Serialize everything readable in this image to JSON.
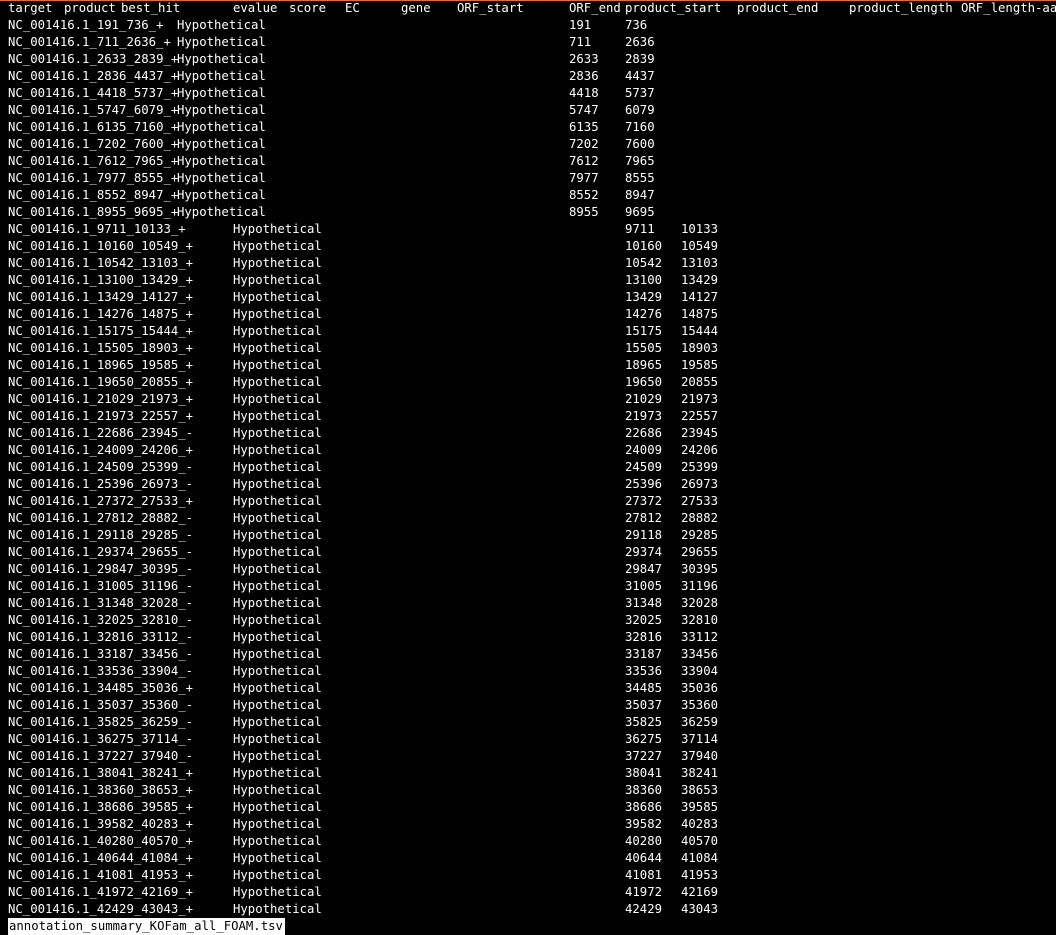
{
  "window": {
    "accent_color": "#e86a2e",
    "background_color": "#000000",
    "text_color": "#ffffff"
  },
  "header": [
    "target",
    "product",
    "best_hit",
    "evalue",
    "score",
    "EC",
    "gene",
    "ORF_start",
    "ORF_end",
    "product_start",
    "product_end",
    "product_length",
    "ORF_length-aa"
  ],
  "rows": [
    {
      "target": "NC_001416.1_191_736_+",
      "product": "Hypothetical",
      "start": "191",
      "end": "736",
      "shifted": false
    },
    {
      "target": "NC_001416.1_711_2636_+",
      "product": "Hypothetical",
      "start": "711",
      "end": "2636",
      "shifted": false
    },
    {
      "target": "NC_001416.1_2633_2839_+",
      "product": "Hypothetical",
      "start": "2633",
      "end": "2839",
      "shifted": false
    },
    {
      "target": "NC_001416.1_2836_4437_+",
      "product": "Hypothetical",
      "start": "2836",
      "end": "4437",
      "shifted": false
    },
    {
      "target": "NC_001416.1_4418_5737_+",
      "product": "Hypothetical",
      "start": "4418",
      "end": "5737",
      "shifted": false
    },
    {
      "target": "NC_001416.1_5747_6079_+",
      "product": "Hypothetical",
      "start": "5747",
      "end": "6079",
      "shifted": false
    },
    {
      "target": "NC_001416.1_6135_7160_+",
      "product": "Hypothetical",
      "start": "6135",
      "end": "7160",
      "shifted": false
    },
    {
      "target": "NC_001416.1_7202_7600_+",
      "product": "Hypothetical",
      "start": "7202",
      "end": "7600",
      "shifted": false
    },
    {
      "target": "NC_001416.1_7612_7965_+",
      "product": "Hypothetical",
      "start": "7612",
      "end": "7965",
      "shifted": false
    },
    {
      "target": "NC_001416.1_7977_8555_+",
      "product": "Hypothetical",
      "start": "7977",
      "end": "8555",
      "shifted": false
    },
    {
      "target": "NC_001416.1_8552_8947_+",
      "product": "Hypothetical",
      "start": "8552",
      "end": "8947",
      "shifted": false
    },
    {
      "target": "NC_001416.1_8955_9695_+",
      "product": "Hypothetical",
      "start": "8955",
      "end": "9695",
      "shifted": false
    },
    {
      "target": "NC_001416.1_9711_10133_+",
      "product": "Hypothetical",
      "start": "9711",
      "end": "10133",
      "shifted": true
    },
    {
      "target": "NC_001416.1_10160_10549_+",
      "product": "Hypothetical",
      "start": "10160",
      "end": "10549",
      "shifted": true
    },
    {
      "target": "NC_001416.1_10542_13103_+",
      "product": "Hypothetical",
      "start": "10542",
      "end": "13103",
      "shifted": true
    },
    {
      "target": "NC_001416.1_13100_13429_+",
      "product": "Hypothetical",
      "start": "13100",
      "end": "13429",
      "shifted": true
    },
    {
      "target": "NC_001416.1_13429_14127_+",
      "product": "Hypothetical",
      "start": "13429",
      "end": "14127",
      "shifted": true
    },
    {
      "target": "NC_001416.1_14276_14875_+",
      "product": "Hypothetical",
      "start": "14276",
      "end": "14875",
      "shifted": true
    },
    {
      "target": "NC_001416.1_15175_15444_+",
      "product": "Hypothetical",
      "start": "15175",
      "end": "15444",
      "shifted": true
    },
    {
      "target": "NC_001416.1_15505_18903_+",
      "product": "Hypothetical",
      "start": "15505",
      "end": "18903",
      "shifted": true
    },
    {
      "target": "NC_001416.1_18965_19585_+",
      "product": "Hypothetical",
      "start": "18965",
      "end": "19585",
      "shifted": true
    },
    {
      "target": "NC_001416.1_19650_20855_+",
      "product": "Hypothetical",
      "start": "19650",
      "end": "20855",
      "shifted": true
    },
    {
      "target": "NC_001416.1_21029_21973_+",
      "product": "Hypothetical",
      "start": "21029",
      "end": "21973",
      "shifted": true
    },
    {
      "target": "NC_001416.1_21973_22557_+",
      "product": "Hypothetical",
      "start": "21973",
      "end": "22557",
      "shifted": true
    },
    {
      "target": "NC_001416.1_22686_23945_-",
      "product": "Hypothetical",
      "start": "22686",
      "end": "23945",
      "shifted": true
    },
    {
      "target": "NC_001416.1_24009_24206_+",
      "product": "Hypothetical",
      "start": "24009",
      "end": "24206",
      "shifted": true
    },
    {
      "target": "NC_001416.1_24509_25399_-",
      "product": "Hypothetical",
      "start": "24509",
      "end": "25399",
      "shifted": true
    },
    {
      "target": "NC_001416.1_25396_26973_-",
      "product": "Hypothetical",
      "start": "25396",
      "end": "26973",
      "shifted": true
    },
    {
      "target": "NC_001416.1_27372_27533_+",
      "product": "Hypothetical",
      "start": "27372",
      "end": "27533",
      "shifted": true
    },
    {
      "target": "NC_001416.1_27812_28882_-",
      "product": "Hypothetical",
      "start": "27812",
      "end": "28882",
      "shifted": true
    },
    {
      "target": "NC_001416.1_29118_29285_-",
      "product": "Hypothetical",
      "start": "29118",
      "end": "29285",
      "shifted": true
    },
    {
      "target": "NC_001416.1_29374_29655_-",
      "product": "Hypothetical",
      "start": "29374",
      "end": "29655",
      "shifted": true
    },
    {
      "target": "NC_001416.1_29847_30395_-",
      "product": "Hypothetical",
      "start": "29847",
      "end": "30395",
      "shifted": true
    },
    {
      "target": "NC_001416.1_31005_31196_-",
      "product": "Hypothetical",
      "start": "31005",
      "end": "31196",
      "shifted": true
    },
    {
      "target": "NC_001416.1_31348_32028_-",
      "product": "Hypothetical",
      "start": "31348",
      "end": "32028",
      "shifted": true
    },
    {
      "target": "NC_001416.1_32025_32810_-",
      "product": "Hypothetical",
      "start": "32025",
      "end": "32810",
      "shifted": true
    },
    {
      "target": "NC_001416.1_32816_33112_-",
      "product": "Hypothetical",
      "start": "32816",
      "end": "33112",
      "shifted": true
    },
    {
      "target": "NC_001416.1_33187_33456_-",
      "product": "Hypothetical",
      "start": "33187",
      "end": "33456",
      "shifted": true
    },
    {
      "target": "NC_001416.1_33536_33904_-",
      "product": "Hypothetical",
      "start": "33536",
      "end": "33904",
      "shifted": true
    },
    {
      "target": "NC_001416.1_34485_35036_+",
      "product": "Hypothetical",
      "start": "34485",
      "end": "35036",
      "shifted": true
    },
    {
      "target": "NC_001416.1_35037_35360_-",
      "product": "Hypothetical",
      "start": "35037",
      "end": "35360",
      "shifted": true
    },
    {
      "target": "NC_001416.1_35825_36259_-",
      "product": "Hypothetical",
      "start": "35825",
      "end": "36259",
      "shifted": true
    },
    {
      "target": "NC_001416.1_36275_37114_-",
      "product": "Hypothetical",
      "start": "36275",
      "end": "37114",
      "shifted": true
    },
    {
      "target": "NC_001416.1_37227_37940_-",
      "product": "Hypothetical",
      "start": "37227",
      "end": "37940",
      "shifted": true
    },
    {
      "target": "NC_001416.1_38041_38241_+",
      "product": "Hypothetical",
      "start": "38041",
      "end": "38241",
      "shifted": true
    },
    {
      "target": "NC_001416.1_38360_38653_+",
      "product": "Hypothetical",
      "start": "38360",
      "end": "38653",
      "shifted": true
    },
    {
      "target": "NC_001416.1_38686_39585_+",
      "product": "Hypothetical",
      "start": "38686",
      "end": "39585",
      "shifted": true
    },
    {
      "target": "NC_001416.1_39582_40283_+",
      "product": "Hypothetical",
      "start": "39582",
      "end": "40283",
      "shifted": true
    },
    {
      "target": "NC_001416.1_40280_40570_+",
      "product": "Hypothetical",
      "start": "40280",
      "end": "40570",
      "shifted": true
    },
    {
      "target": "NC_001416.1_40644_41084_+",
      "product": "Hypothetical",
      "start": "40644",
      "end": "41084",
      "shifted": true
    },
    {
      "target": "NC_001416.1_41081_41953_+",
      "product": "Hypothetical",
      "start": "41081",
      "end": "41953",
      "shifted": true
    },
    {
      "target": "NC_001416.1_41972_42169_+",
      "product": "Hypothetical",
      "start": "41972",
      "end": "42169",
      "shifted": true
    },
    {
      "target": "NC_001416.1_42429_43043_+",
      "product": "Hypothetical",
      "start": "42429",
      "end": "43043",
      "shifted": true
    }
  ],
  "status_bar": {
    "filename": "annotation_summary_KOFam_all_FOAM.tsv"
  }
}
